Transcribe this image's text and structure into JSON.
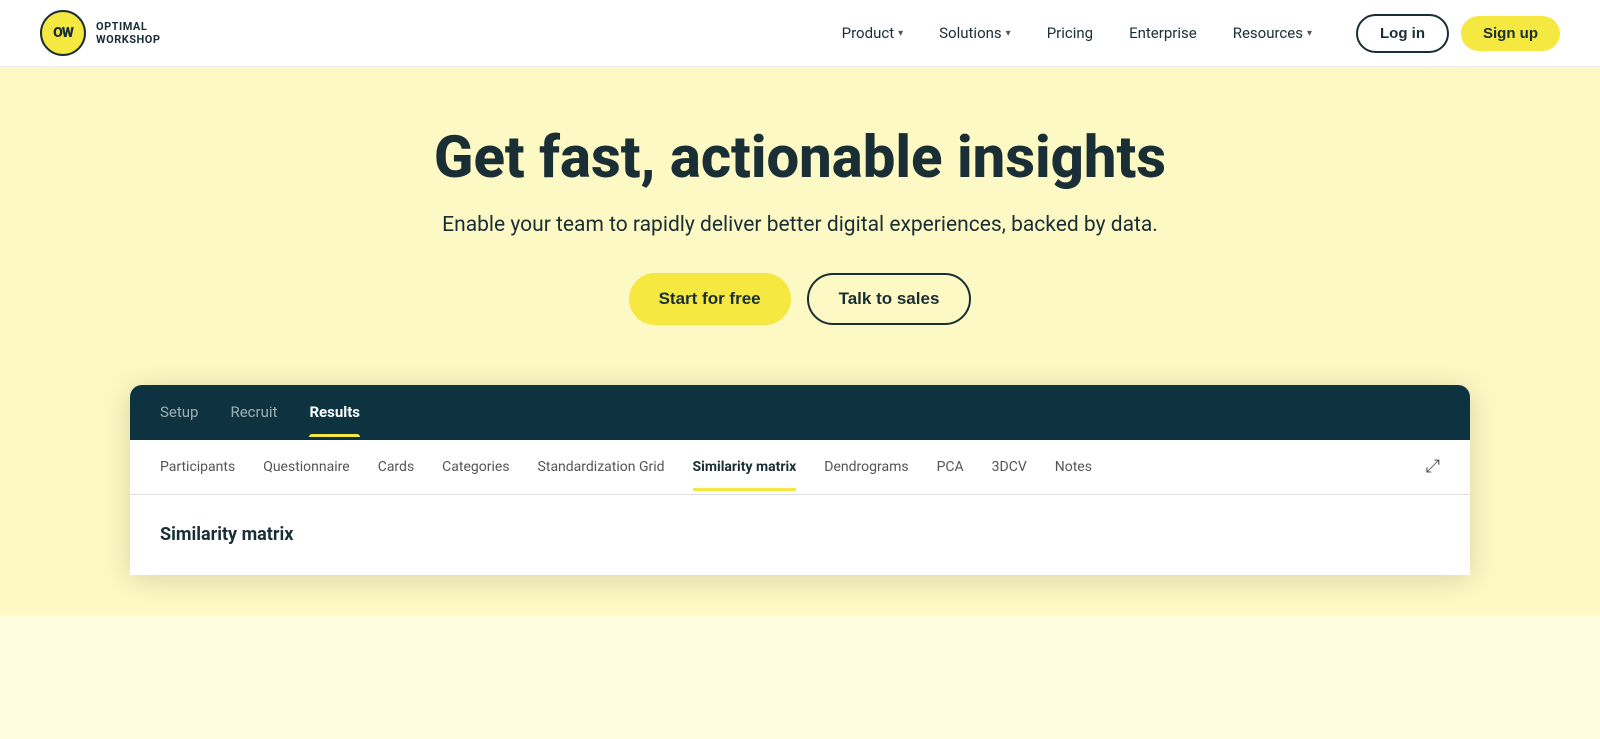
{
  "brand": {
    "logo_text": "OW",
    "company_line1": "OPTIMAL",
    "company_line2": "WORKSHOP"
  },
  "nav": {
    "links": [
      {
        "label": "Product",
        "has_dropdown": true
      },
      {
        "label": "Solutions",
        "has_dropdown": true
      },
      {
        "label": "Pricing",
        "has_dropdown": false
      },
      {
        "label": "Enterprise",
        "has_dropdown": false
      },
      {
        "label": "Resources",
        "has_dropdown": true
      }
    ],
    "login_label": "Log in",
    "signup_label": "Sign up"
  },
  "hero": {
    "heading": "Get fast, actionable insights",
    "subheading": "Enable your team to rapidly deliver better digital experiences, backed by data.",
    "cta_primary": "Start for free",
    "cta_secondary": "Talk to sales"
  },
  "demo": {
    "top_tabs": [
      {
        "label": "Setup",
        "active": false
      },
      {
        "label": "Recruit",
        "active": false
      },
      {
        "label": "Results",
        "active": true
      }
    ],
    "sub_tabs": [
      {
        "label": "Participants",
        "active": false
      },
      {
        "label": "Questionnaire",
        "active": false
      },
      {
        "label": "Cards",
        "active": false
      },
      {
        "label": "Categories",
        "active": false
      },
      {
        "label": "Standardization Grid",
        "active": false
      },
      {
        "label": "Similarity matrix",
        "active": true
      },
      {
        "label": "Dendrograms",
        "active": false
      },
      {
        "label": "PCA",
        "active": false
      },
      {
        "label": "3DCV",
        "active": false
      },
      {
        "label": "Notes",
        "active": false
      }
    ],
    "content_title": "Similarity matrix"
  }
}
